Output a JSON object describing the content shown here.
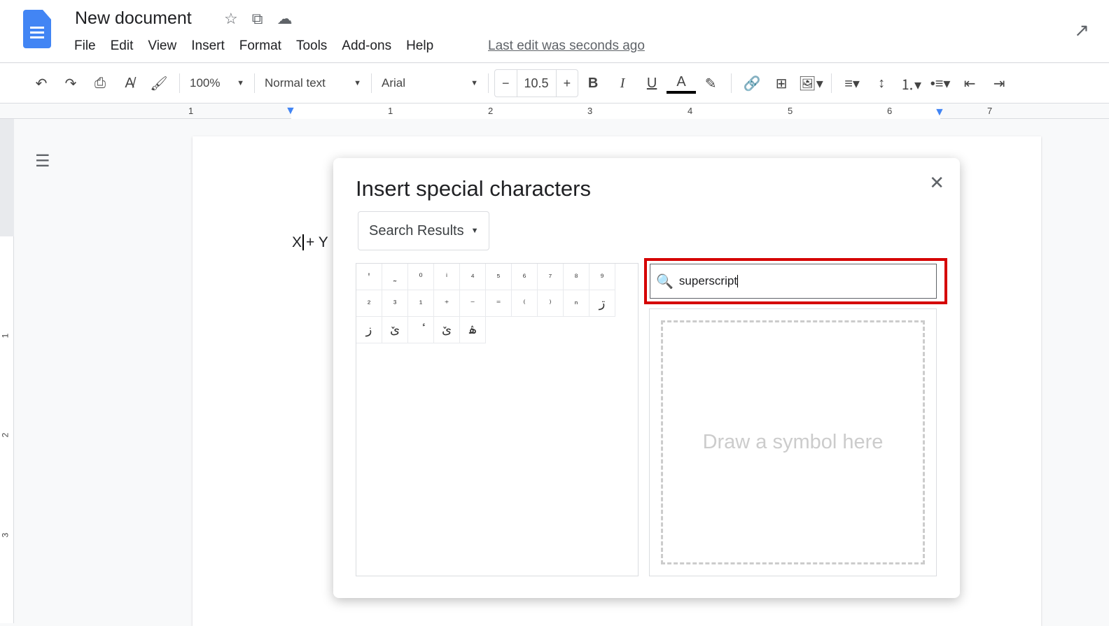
{
  "app": {
    "title": "New document",
    "title_icons": [
      "star-icon",
      "move-folder-icon",
      "cloud-saved-icon"
    ],
    "menu": [
      "File",
      "Edit",
      "View",
      "Insert",
      "Format",
      "Tools",
      "Add-ons",
      "Help"
    ],
    "last_edit": "Last edit was seconds ago"
  },
  "toolbar": {
    "zoom": "100%",
    "style": "Normal text",
    "font": "Arial",
    "font_size": "10.5"
  },
  "ruler": {
    "h_numbers": [
      "1",
      "1",
      "2",
      "3",
      "4",
      "5",
      "6",
      "7"
    ],
    "v_numbers": [
      "1",
      "2",
      "3"
    ]
  },
  "document": {
    "text_before": "X",
    "text_after": "+ Y"
  },
  "dialog": {
    "title": "Insert special characters",
    "category": "Search Results",
    "characters": [
      "ꞌ",
      "˷",
      "⁰",
      "ⁱ",
      "⁴",
      "⁵",
      "⁶",
      "⁷",
      "⁸",
      "⁹",
      "²",
      "³",
      "¹",
      "⁺",
      "⁻",
      "⁼",
      "⁽",
      "⁾",
      "ⁿ",
      "ڗ",
      "ز",
      "ێ",
      "ٔ",
      "ێ",
      "ۿ"
    ],
    "search_value": "superscript",
    "draw_placeholder": "Draw a symbol here",
    "highlight_color": "#d50000"
  }
}
